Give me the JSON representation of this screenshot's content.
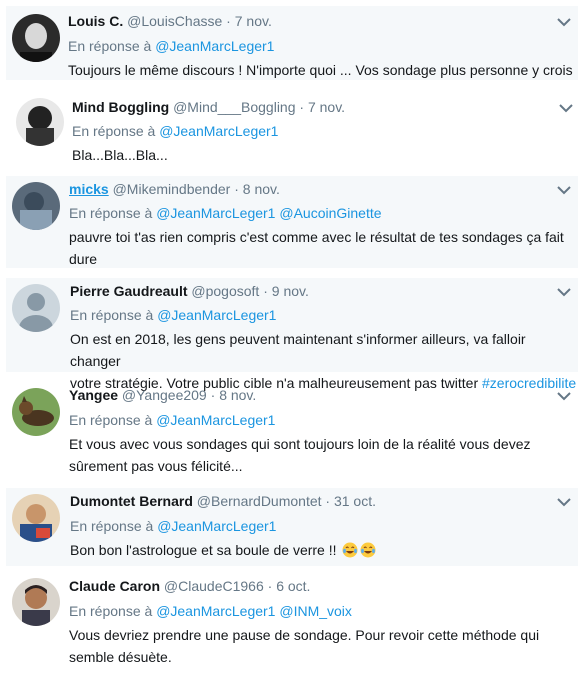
{
  "reply_prefix": "En réponse à",
  "accent": "#1b95e0",
  "tweets": [
    {
      "name": "Louis C.",
      "handle": "@LouisChasse",
      "sep": "·",
      "date": "7 nov.",
      "mentions": [
        "@JeanMarcLeger1"
      ],
      "text": "Toujours le même discours ! N'importe quoi ... Vos sondage plus personne y crois"
    },
    {
      "name": "Mind Boggling",
      "handle": "@Mind___Boggling",
      "sep": "·",
      "date": "7 nov.",
      "mentions": [
        "@JeanMarcLeger1"
      ],
      "text": "Bla...Bla...Bla..."
    },
    {
      "name": "micks",
      "handle": "@Mikemindbender",
      "sep": "·",
      "date": "8 nov.",
      "mentions": [
        "@JeanMarcLeger1",
        "@AucoinGinette"
      ],
      "text_line1": "pauvre toi t'as rien compris c'est comme avec le résultat de tes sondages ça fait",
      "text_line2": "dure"
    },
    {
      "name": "Pierre Gaudreault",
      "handle": "@pogosoft",
      "sep": "·",
      "date": "9 nov.",
      "mentions": [
        "@JeanMarcLeger1"
      ],
      "text_line1": "On est en 2018, les gens peuvent maintenant s'informer ailleurs, va falloir changer",
      "text_line2": "votre stratégie. Votre public cible n'a malheureusement pas twitter",
      "hashtag": "#zerocredibilite"
    },
    {
      "name": "Yangee",
      "handle": "@Yangee209",
      "sep": "·",
      "date": "8 nov.",
      "mentions": [
        "@JeanMarcLeger1"
      ],
      "text_line1": "Et vous avec vous sondages qui sont toujours loin de la réalité vous devez",
      "text_line2": "sûrement pas vous félicité..."
    },
    {
      "name": "Dumontet Bernard",
      "handle": "@BernardDumontet",
      "sep": "·",
      "date": "31 oct.",
      "mentions": [
        "@JeanMarcLeger1"
      ],
      "text": "Bon bon l'astrologue et sa boule de verre !!"
    },
    {
      "name": "Claude Caron",
      "handle": "@ClaudeC1966",
      "sep": "·",
      "date": "6 oct.",
      "mentions": [
        "@JeanMarcLeger1",
        "@INM_voix"
      ],
      "text_line1": "Vous devriez prendre une pause de sondage. Pour revoir cette méthode qui",
      "text_line2": "semble désuète."
    }
  ]
}
